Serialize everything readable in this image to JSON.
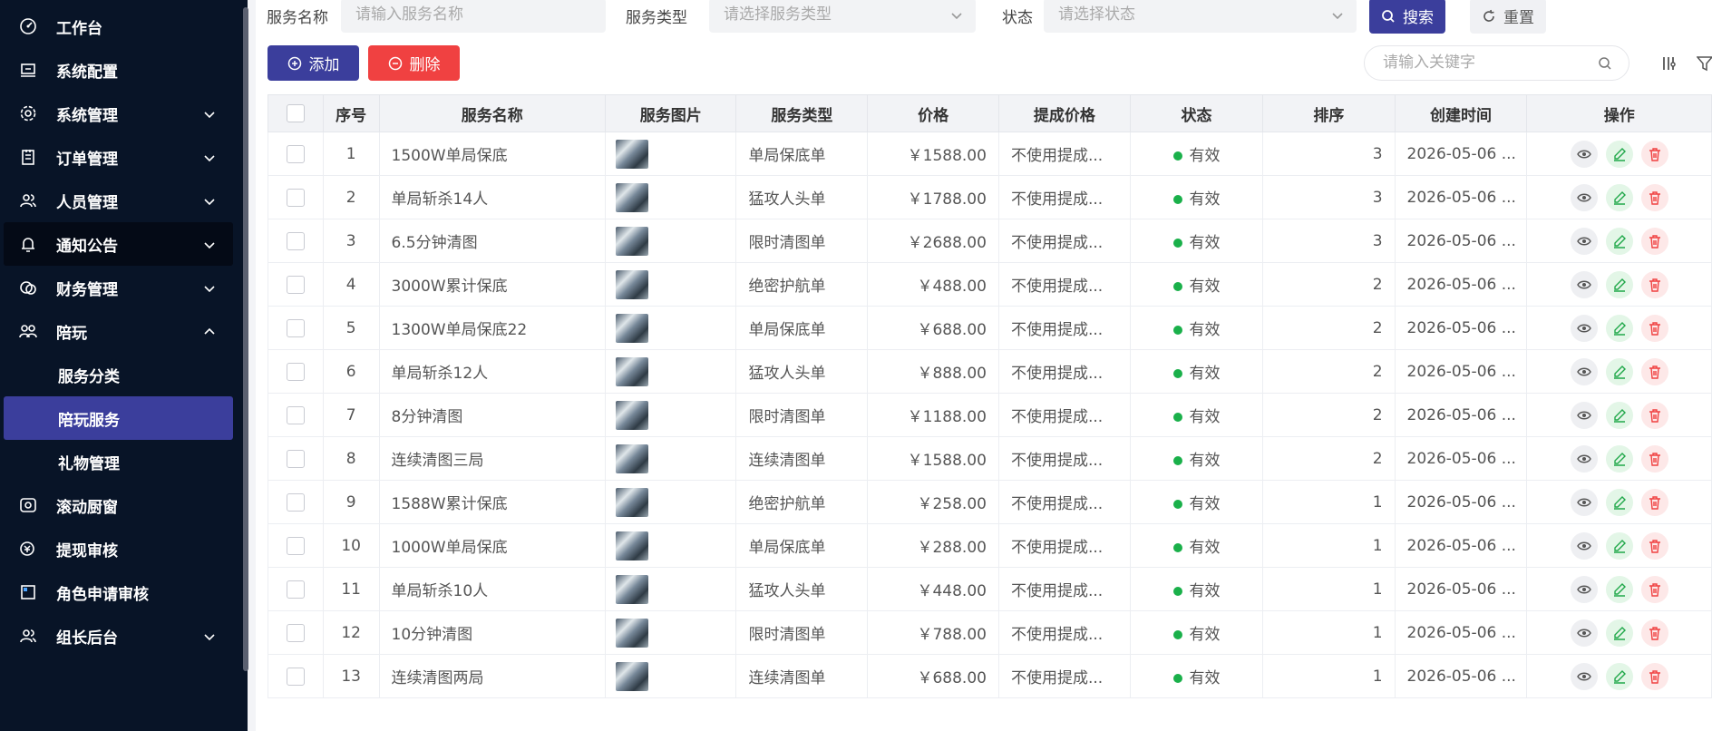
{
  "sidebar": {
    "items": [
      {
        "label": "工作台",
        "icon": "dashboard-icon",
        "chev": ""
      },
      {
        "label": "系统配置",
        "icon": "monitor-icon",
        "chev": ""
      },
      {
        "label": "系统管理",
        "icon": "gear-icon",
        "chev": "down"
      },
      {
        "label": "订单管理",
        "icon": "clipboard-icon",
        "chev": "down"
      },
      {
        "label": "人员管理",
        "icon": "users-icon",
        "chev": "down"
      },
      {
        "label": "通知公告",
        "icon": "bell-icon",
        "chev": "down"
      },
      {
        "label": "财务管理",
        "icon": "money-icon",
        "chev": "down"
      },
      {
        "label": "陪玩",
        "icon": "group-icon",
        "chev": "up"
      },
      {
        "label": "服务分类",
        "icon": "",
        "chev": ""
      },
      {
        "label": "陪玩服务",
        "icon": "",
        "chev": ""
      },
      {
        "label": "礼物管理",
        "icon": "",
        "chev": ""
      },
      {
        "label": "滚动厨窗",
        "icon": "window-icon",
        "chev": ""
      },
      {
        "label": "提现审核",
        "icon": "withdraw-icon",
        "chev": ""
      },
      {
        "label": "角色申请审核",
        "icon": "square-icon",
        "chev": ""
      },
      {
        "label": "组长后台",
        "icon": "users-icon",
        "chev": "down"
      }
    ]
  },
  "filters": {
    "name_label": "服务名称",
    "name_placeholder": "请输入服务名称",
    "type_label": "服务类型",
    "type_placeholder": "请选择服务类型",
    "status_label": "状态",
    "status_placeholder": "请选择状态",
    "search_label": "搜索",
    "reset_label": "重置"
  },
  "toolbar": {
    "add_label": "添加",
    "delete_label": "删除",
    "keyword_placeholder": "请输入关键字"
  },
  "table": {
    "columns": [
      "序号",
      "服务名称",
      "服务图片",
      "服务类型",
      "价格",
      "提成价格",
      "状态",
      "排序",
      "创建时间",
      "操作"
    ],
    "rows": [
      {
        "no": "1",
        "name": "1500W单局保底",
        "type": "单局保底单",
        "price": "￥1588.00",
        "comm": "不使用提成...",
        "status": "有效",
        "sort": "3",
        "created": "2026-05-06 ..."
      },
      {
        "no": "2",
        "name": "单局斩杀14人",
        "type": "猛攻人头单",
        "price": "￥1788.00",
        "comm": "不使用提成...",
        "status": "有效",
        "sort": "3",
        "created": "2026-05-06 ..."
      },
      {
        "no": "3",
        "name": "6.5分钟清图",
        "type": "限时清图单",
        "price": "￥2688.00",
        "comm": "不使用提成...",
        "status": "有效",
        "sort": "3",
        "created": "2026-05-06 ..."
      },
      {
        "no": "4",
        "name": "3000W累计保底",
        "type": "绝密护航单",
        "price": "￥488.00",
        "comm": "不使用提成...",
        "status": "有效",
        "sort": "2",
        "created": "2026-05-06 ..."
      },
      {
        "no": "5",
        "name": "1300W单局保底22",
        "type": "单局保底单",
        "price": "￥688.00",
        "comm": "不使用提成...",
        "status": "有效",
        "sort": "2",
        "created": "2026-05-06 ..."
      },
      {
        "no": "6",
        "name": "单局斩杀12人",
        "type": "猛攻人头单",
        "price": "￥888.00",
        "comm": "不使用提成...",
        "status": "有效",
        "sort": "2",
        "created": "2026-05-06 ..."
      },
      {
        "no": "7",
        "name": "8分钟清图",
        "type": "限时清图单",
        "price": "￥1188.00",
        "comm": "不使用提成...",
        "status": "有效",
        "sort": "2",
        "created": "2026-05-06 ..."
      },
      {
        "no": "8",
        "name": "连续清图三局",
        "type": "连续清图单",
        "price": "￥1588.00",
        "comm": "不使用提成...",
        "status": "有效",
        "sort": "2",
        "created": "2026-05-06 ..."
      },
      {
        "no": "9",
        "name": "1588W累计保底",
        "type": "绝密护航单",
        "price": "￥258.00",
        "comm": "不使用提成...",
        "status": "有效",
        "sort": "1",
        "created": "2026-05-06 ..."
      },
      {
        "no": "10",
        "name": "1000W单局保底",
        "type": "单局保底单",
        "price": "￥288.00",
        "comm": "不使用提成...",
        "status": "有效",
        "sort": "1",
        "created": "2026-05-06 ..."
      },
      {
        "no": "11",
        "name": "单局斩杀10人",
        "type": "猛攻人头单",
        "price": "￥448.00",
        "comm": "不使用提成...",
        "status": "有效",
        "sort": "1",
        "created": "2026-05-06 ..."
      },
      {
        "no": "12",
        "name": "10分钟清图",
        "type": "限时清图单",
        "price": "￥788.00",
        "comm": "不使用提成...",
        "status": "有效",
        "sort": "1",
        "created": "2026-05-06 ..."
      },
      {
        "no": "13",
        "name": "连续清图两局",
        "type": "连续清图单",
        "price": "￥688.00",
        "comm": "不使用提成...",
        "status": "有效",
        "sort": "1",
        "created": "2026-05-06 ..."
      }
    ]
  },
  "colors": {
    "sidebar_bg": "#081427",
    "accent": "#3b3e9c",
    "danger": "#f04141",
    "status_ok": "#1ab04a"
  }
}
